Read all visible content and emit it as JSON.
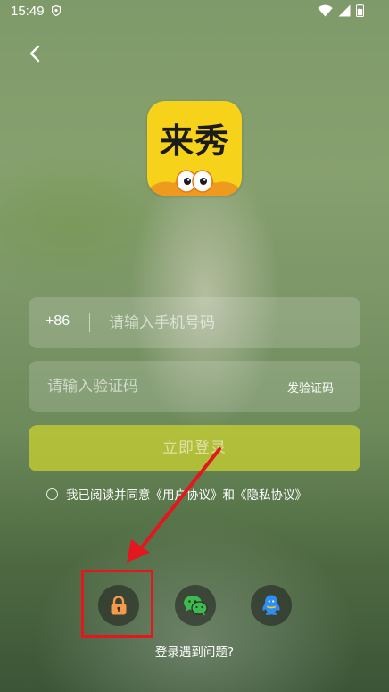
{
  "status_bar": {
    "time": "15:49",
    "icons": [
      "shield-icon",
      "wifi-icon",
      "signal-icon",
      "battery-icon"
    ]
  },
  "header": {
    "back_icon": "chevron-left-icon"
  },
  "logo": {
    "text": "来秀",
    "color": "#f6d21a"
  },
  "phone_field": {
    "country_code": "+86",
    "placeholder": "请输入手机号码",
    "value": ""
  },
  "code_field": {
    "placeholder": "请输入验证码",
    "value": "",
    "send_code_label": "发验证码"
  },
  "login_button": {
    "label": "立即登录",
    "color": "#cdd42e"
  },
  "agreement": {
    "prefix": "我已阅读并同意",
    "user_agreement": "《用户协议》",
    "connector": "和",
    "privacy_policy": "《隐私协议》",
    "checked": false
  },
  "login_options": [
    {
      "name": "password-login",
      "icon": "lock-icon",
      "color": "#f39a4b"
    },
    {
      "name": "wechat-login",
      "icon": "wechat-icon",
      "color": "#3dbb4e"
    },
    {
      "name": "qq-login",
      "icon": "qq-icon",
      "color": "#2f8ff0"
    }
  ],
  "annotation": {
    "color": "#e4161e",
    "highlight_icon": "lock-icon"
  },
  "help": {
    "label": "登录遇到问题?"
  }
}
